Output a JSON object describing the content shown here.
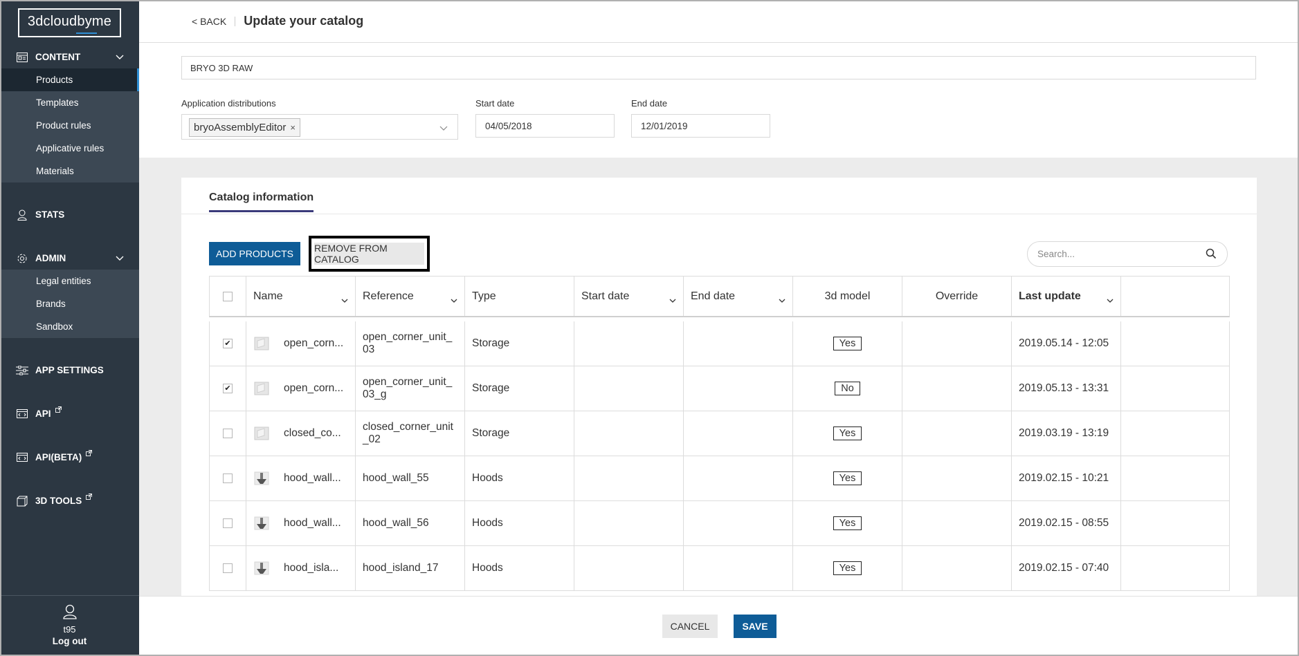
{
  "app": {
    "logo": "3dcloudbyme"
  },
  "sidebar": {
    "content": {
      "label": "CONTENT",
      "items": [
        {
          "label": "Products",
          "active": true
        },
        {
          "label": "Templates"
        },
        {
          "label": "Product rules"
        },
        {
          "label": "Applicative rules"
        },
        {
          "label": "Materials"
        }
      ]
    },
    "stats": {
      "label": "STATS"
    },
    "admin": {
      "label": "ADMIN",
      "items": [
        {
          "label": "Legal entities"
        },
        {
          "label": "Brands"
        },
        {
          "label": "Sandbox"
        }
      ]
    },
    "app_settings": {
      "label": "APP SETTINGS"
    },
    "api": {
      "label": "API"
    },
    "api_beta": {
      "label": "API(BETA)"
    },
    "tools": {
      "label": "3D TOOLS"
    },
    "user": {
      "name": "t95",
      "logout": "Log out"
    }
  },
  "header": {
    "back": "< BACK",
    "title": "Update your catalog"
  },
  "form": {
    "catalog_name": "BRYO 3D RAW",
    "distributions_label": "Application distributions",
    "distribution_tag": "bryoAssemblyEditor",
    "tag_remove": "×",
    "start_label": "Start date",
    "start_value": "04/05/2018",
    "end_label": "End date",
    "end_value": "12/01/2019"
  },
  "catalog": {
    "tab": "Catalog information",
    "add_button": "ADD PRODUCTS",
    "remove_button": "REMOVE FROM CATALOG",
    "search_placeholder": "Search...",
    "columns": {
      "name": "Name",
      "reference": "Reference",
      "type": "Type",
      "start_date": "Start date",
      "end_date": "End date",
      "model3d": "3d model",
      "override": "Override",
      "last_update": "Last update"
    },
    "rows": [
      {
        "checked": true,
        "name": "open_corn...",
        "reference": "open_corner_unit_03",
        "type": "Storage",
        "start_date": "",
        "end_date": "",
        "model3d": "Yes",
        "override": "",
        "last_update": "2019.05.14 - 12:05"
      },
      {
        "checked": true,
        "name": "open_corn...",
        "reference": "open_corner_unit_03_g",
        "type": "Storage",
        "start_date": "",
        "end_date": "",
        "model3d": "No",
        "override": "",
        "last_update": "2019.05.13 - 13:31"
      },
      {
        "checked": false,
        "name": "closed_co...",
        "reference": "closed_corner_unit_02",
        "type": "Storage",
        "start_date": "",
        "end_date": "",
        "model3d": "Yes",
        "override": "",
        "last_update": "2019.03.19 - 13:19"
      },
      {
        "checked": false,
        "name": "hood_wall...",
        "reference": "hood_wall_55",
        "type": "Hoods",
        "start_date": "",
        "end_date": "",
        "model3d": "Yes",
        "override": "",
        "last_update": "2019.02.15 - 10:21"
      },
      {
        "checked": false,
        "name": "hood_wall...",
        "reference": "hood_wall_56",
        "type": "Hoods",
        "start_date": "",
        "end_date": "",
        "model3d": "Yes",
        "override": "",
        "last_update": "2019.02.15 - 08:55"
      },
      {
        "checked": false,
        "name": "hood_isla...",
        "reference": "hood_island_17",
        "type": "Hoods",
        "start_date": "",
        "end_date": "",
        "model3d": "Yes",
        "override": "",
        "last_update": "2019.02.15 - 07:40"
      }
    ]
  },
  "footer": {
    "cancel": "CANCEL",
    "save": "SAVE"
  },
  "colors": {
    "sidebar": "#2c3742",
    "accent": "#0e5c97",
    "active_item": "#1c2731",
    "highlight": "#2f8fd5"
  }
}
